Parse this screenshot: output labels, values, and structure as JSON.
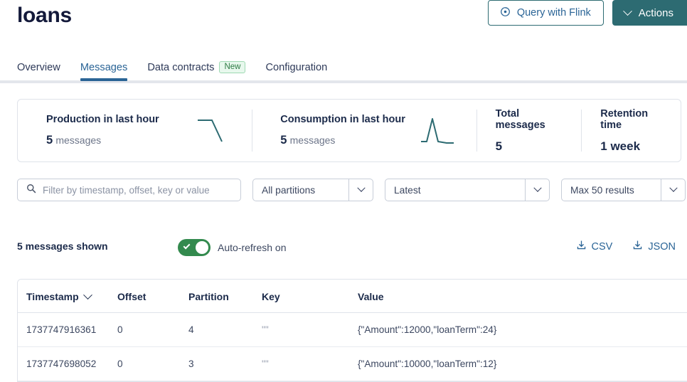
{
  "header": {
    "title": "loans",
    "flink_button": "Query with Flink",
    "actions_button": "Actions"
  },
  "tabs": [
    {
      "label": "Overview",
      "active": false,
      "badge": null
    },
    {
      "label": "Messages",
      "active": true,
      "badge": null
    },
    {
      "label": "Data contracts",
      "active": false,
      "badge": "New"
    },
    {
      "label": "Configuration",
      "active": false,
      "badge": null
    }
  ],
  "stats": [
    {
      "label": "Production in last hour",
      "value": "5",
      "unit": "messages",
      "spark": "down-step"
    },
    {
      "label": "Consumption in last hour",
      "value": "5",
      "unit": "messages",
      "spark": "peak"
    },
    {
      "label": "Total messages",
      "value": "5",
      "unit": ""
    },
    {
      "label": "Retention time",
      "value": "1 week",
      "unit": ""
    }
  ],
  "filters": {
    "search_placeholder": "Filter by timestamp, offset, key or value",
    "search_value": "",
    "partition_select": "All partitions",
    "offset_select": "Latest",
    "max_results_select": "Max 50 results"
  },
  "toolbar": {
    "messages_shown": "5 messages shown",
    "auto_refresh_label": "Auto-refresh on",
    "auto_refresh_on": true,
    "export_csv": "CSV",
    "export_json": "JSON"
  },
  "table": {
    "columns": [
      "Timestamp",
      "Offset",
      "Partition",
      "Key",
      "Value"
    ],
    "sorted_column": "Timestamp",
    "rows": [
      {
        "timestamp": "1737747916361",
        "offset": "0",
        "partition": "4",
        "key": "\"\"",
        "value": "{\"Amount\":12000,\"loanTerm\":24}"
      },
      {
        "timestamp": "1737747698052",
        "offset": "0",
        "partition": "3",
        "key": "\"\"",
        "value": "{\"Amount\":10000,\"loanTerm\":12}"
      }
    ]
  },
  "colors": {
    "teal": "#2d6b72",
    "blue": "#2a6496",
    "green": "#338a4e",
    "badge_green": "#2d7a43",
    "spark_line": "#2d6b72"
  }
}
